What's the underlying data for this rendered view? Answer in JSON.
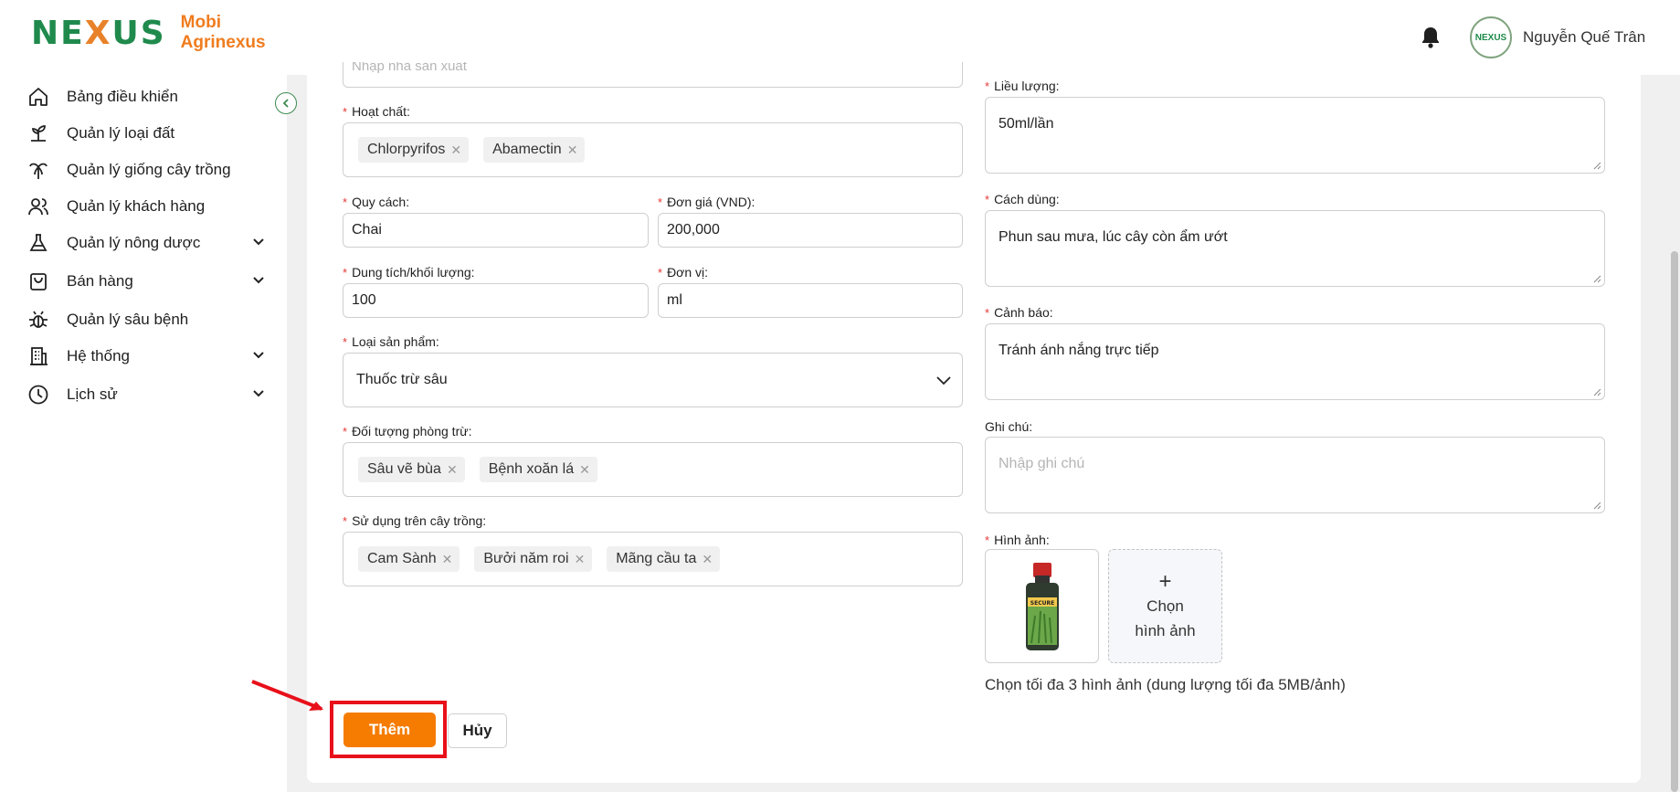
{
  "header": {
    "logo_text_1": "NE",
    "logo_text_x": "X",
    "logo_text_2": "US",
    "brand_line_1": "Mobi",
    "brand_line_2": "Agrinexus",
    "avatar_text": "NEXUS",
    "username": "Nguyễn Quế Trân",
    "bell_icon": "bell-icon"
  },
  "sidebar": {
    "items": [
      {
        "label": "Bảng điều khiển",
        "icon": "home-icon",
        "has_submenu": false
      },
      {
        "label": "Quản lý loại đất",
        "icon": "soil-icon",
        "has_submenu": false
      },
      {
        "label": "Quản lý giống cây trồng",
        "icon": "palm-tree-icon",
        "has_submenu": false
      },
      {
        "label": "Quản lý khách hàng",
        "icon": "users-icon",
        "has_submenu": false
      },
      {
        "label": "Quản lý nông dược",
        "icon": "flask-icon",
        "has_submenu": true
      },
      {
        "label": "Bán hàng",
        "icon": "shopping-bag-icon",
        "has_submenu": true
      },
      {
        "label": "Quản lý sâu bệnh",
        "icon": "bug-icon",
        "has_submenu": false
      },
      {
        "label": "Hệ thống",
        "icon": "building-icon",
        "has_submenu": true
      },
      {
        "label": "Lịch sử",
        "icon": "clock-icon",
        "has_submenu": true
      }
    ]
  },
  "form": {
    "top_partial_placeholder": "Nhập nhà sản xuất",
    "active_ingredient": {
      "label": "Hoạt chất:",
      "tags": [
        "Chlorpyrifos",
        "Abamectin"
      ]
    },
    "packaging": {
      "label": "Quy cách:",
      "value": "Chai"
    },
    "unit_price": {
      "label": "Đơn giá (VND):",
      "value": "200,000"
    },
    "volume": {
      "label": "Dung tích/khối lượng:",
      "value": "100"
    },
    "unit": {
      "label": "Đơn vị:",
      "value": "ml"
    },
    "product_type": {
      "label": "Loại sản phẩm:",
      "value": "Thuốc trừ sâu"
    },
    "target_pests": {
      "label": "Đối tượng phòng trừ:",
      "tags": [
        "Sâu vẽ bùa",
        "Bệnh xoăn lá"
      ]
    },
    "crops": {
      "label": "Sử dụng trên cây trồng:",
      "tags": [
        "Cam Sành",
        "Bưởi năm roi",
        "Mãng cầu ta"
      ]
    },
    "dosage": {
      "label": "Liều lượng:",
      "value": "50ml/lần"
    },
    "usage": {
      "label": "Cách dùng:",
      "value": "Phun sau mưa, lúc cây còn ẩm ướt"
    },
    "warning": {
      "label": "Cảnh báo:",
      "value": "Tránh ánh nắng trực tiếp"
    },
    "note": {
      "label": "Ghi chú:",
      "placeholder": "Nhập ghi chú"
    },
    "images": {
      "label": "Hình ảnh:",
      "upload_line_1": "Chọn",
      "upload_line_2": "hình ảnh",
      "hint": "Chọn tối đa 3 hình ảnh (dung lượng tối đa 5MB/ảnh)",
      "thumb_label": "SECURE"
    }
  },
  "actions": {
    "submit_label": "Thêm",
    "cancel_label": "Hủy"
  },
  "colors": {
    "primary": "#f57c00",
    "brand_green": "#1f8a4c",
    "required": "#e53935",
    "highlight": "#e8101a"
  }
}
